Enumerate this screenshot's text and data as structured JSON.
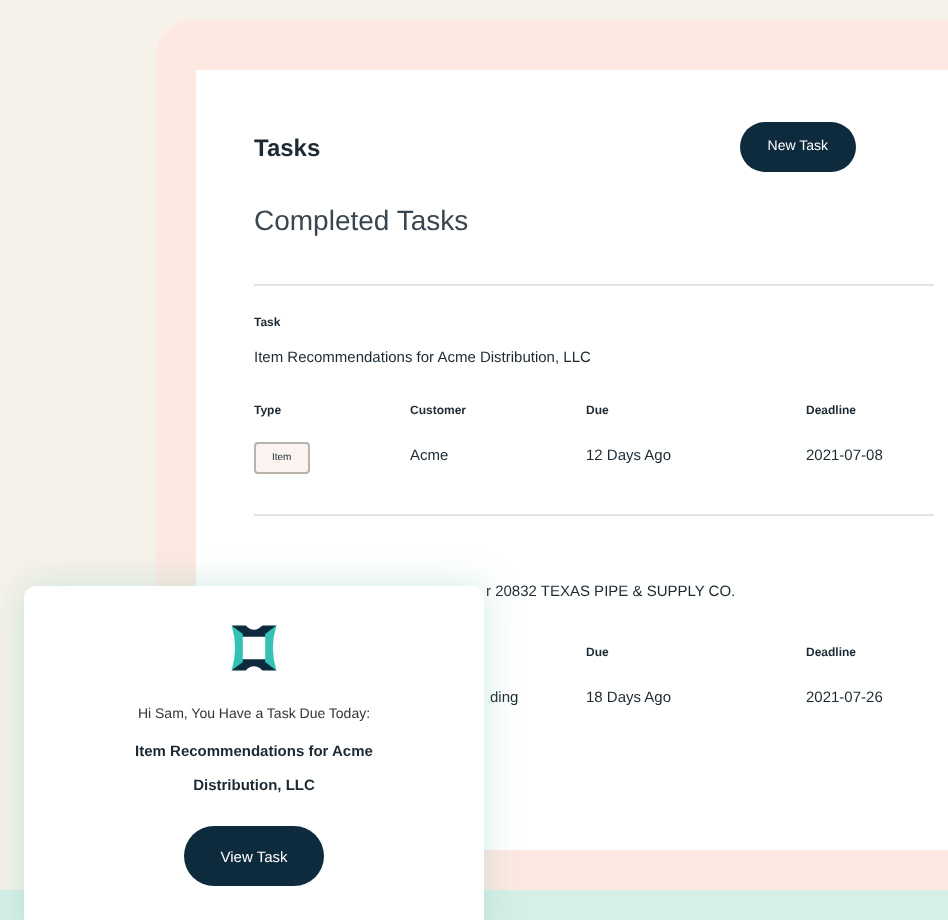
{
  "header": {
    "title": "Tasks",
    "button": "New Task"
  },
  "section_title": "Completed Tasks",
  "tasks": [
    {
      "task_label": "Task",
      "task": "Item Recommendations for Acme Distribution, LLC",
      "fields": [
        {
          "label": "Type",
          "value": "Item",
          "kind": "tag"
        },
        {
          "label": "Customer",
          "value": "Acme",
          "kind": "text"
        },
        {
          "label": "Due",
          "value": "12 Days Ago",
          "kind": "text"
        },
        {
          "label": "Deadline",
          "value": "2021-07-08",
          "kind": "text"
        }
      ]
    },
    {
      "task": "r 20832 TEXAS PIPE & SUPPLY CO.",
      "fields": [
        {
          "value": "ding",
          "kind": "text"
        },
        {
          "label": "Due",
          "value": "18 Days Ago",
          "kind": "text"
        },
        {
          "label": "Deadline",
          "value": "2021-07-26",
          "kind": "text"
        }
      ]
    }
  ],
  "notification": {
    "greeting": "Hi Sam, You Have a Task Due Today:",
    "task": "Item Recommendations for Acme Distribution, LLC",
    "button": "View Task"
  }
}
